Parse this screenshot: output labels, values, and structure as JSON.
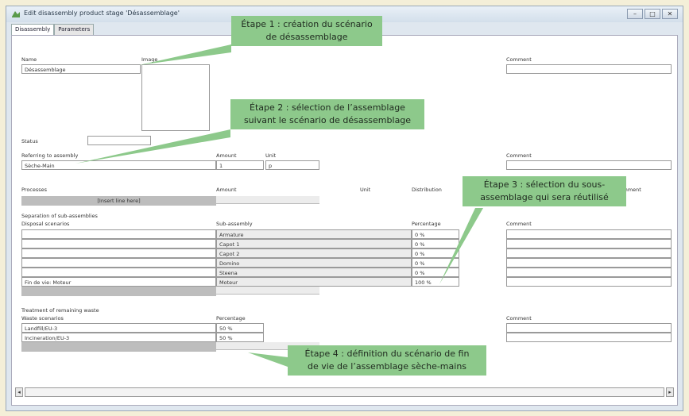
{
  "window": {
    "title": "Edit disassembly product stage 'Désassemblage'",
    "buttons": [
      "–",
      "□",
      "✕"
    ]
  },
  "tabs": [
    "Disassembly",
    "Parameters"
  ],
  "section1": {
    "name_label": "Name",
    "image_label": "Image",
    "comment_label": "Comment",
    "name_value": "Désassemblage",
    "status_label": "Status",
    "status_value": "",
    "comment_value": ""
  },
  "section2": {
    "referring_label": "Referring to assembly",
    "assembly_value": "Sèche-Main",
    "amount_label": "Amount",
    "amount_value": "1",
    "unit_label": "Unit",
    "unit_value": "p",
    "comment_label": "Comment"
  },
  "processes": {
    "processes_label": "Processes",
    "insert_label": "[Insert line here]",
    "amount_label": "Amount",
    "unit_label": "Unit",
    "distribution_label": "Distribution",
    "comment_label": "Comment"
  },
  "separation": {
    "header": "Separation of sub-assemblies",
    "disposal_label": "Disposal scenarios",
    "subassembly_label": "Sub-assembly",
    "percentage_label": "Percentage",
    "comment_label": "Comment",
    "rows": [
      {
        "scenario": "",
        "sub": "Armature",
        "pct": "0 %"
      },
      {
        "scenario": "",
        "sub": "Capot 1",
        "pct": "0 %"
      },
      {
        "scenario": "",
        "sub": "Capot 2",
        "pct": "0 %"
      },
      {
        "scenario": "",
        "sub": "Domino",
        "pct": "0 %"
      },
      {
        "scenario": "",
        "sub": "Steena",
        "pct": "0 %"
      },
      {
        "scenario": "Fin de vie: Moteur",
        "sub": "Moteur",
        "pct": "100 %"
      }
    ]
  },
  "treatment": {
    "header": "Treatment of remaining waste",
    "waste_label": "Waste scenarios",
    "percentage_label": "Percentage",
    "comment_label": "Comment",
    "rows": [
      {
        "scenario": "Landfill/EU-3",
        "pct": "50 %"
      },
      {
        "scenario": "Incineration/EU-3",
        "pct": "50 %"
      }
    ]
  },
  "callouts": {
    "c1": [
      "Étape 1 : création du scénario",
      "de désassemblage"
    ],
    "c2": [
      "Étape 2 : sélection de l’assemblage",
      "suivant le scénario de désassemblage"
    ],
    "c3": [
      "Étape 3 : sélection du sous-",
      "assemblage qui sera réutilisé"
    ],
    "c4": [
      "Étape 4 : définition du scénario de fin",
      "de vie de l’assemblage sèche-mains"
    ]
  },
  "colors": {
    "callout": "#8dc98b",
    "background": "#f4efd8"
  }
}
